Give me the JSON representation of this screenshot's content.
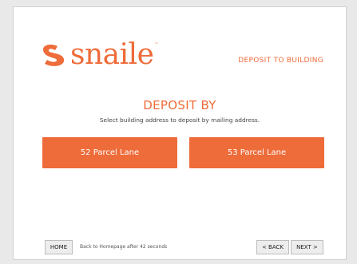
{
  "brand": {
    "name": "snaile",
    "trademark": "™",
    "accent_color": "#ee6c3a"
  },
  "header": {
    "title": "DEPOSIT TO BUILDING"
  },
  "main": {
    "title": "DEPOSIT BY",
    "subtitle": "Select building address to deposit by mailing address.",
    "addresses": [
      "52 Parcel Lane",
      "53 Parcel Lane"
    ]
  },
  "footer": {
    "home_label": "HOME",
    "home_note": "Back to Homepage after 42 seconds",
    "back_label": "< BACK",
    "next_label": "NEXT >"
  }
}
